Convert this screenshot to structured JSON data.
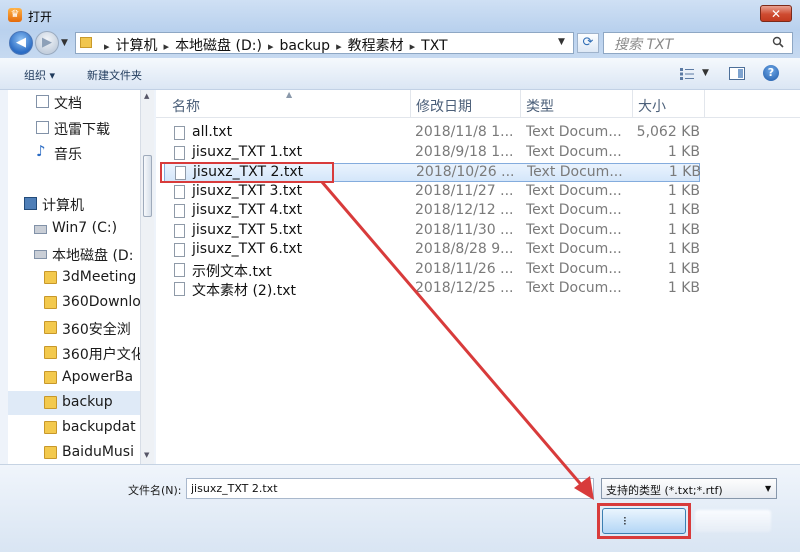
{
  "window": {
    "title": "打开",
    "close_glyph": "✕",
    "app_icon_glyph": "♛"
  },
  "nav": {
    "back_glyph": "◀",
    "forward_glyph": "▶",
    "breadcrumb": [
      "计算机",
      "本地磁盘 (D:)",
      "backup",
      "教程素材",
      "TXT"
    ],
    "breadcrumb_separator": "▸",
    "refresh_glyph": "⟳",
    "search_placeholder": "搜索 TXT"
  },
  "toolbar": {
    "organize_label": "组织 ▾",
    "newfolder_label": "新建文件夹",
    "help_glyph": "?"
  },
  "sidebar": {
    "items": [
      {
        "label": "文档",
        "icon": "doc"
      },
      {
        "label": "迅雷下载",
        "icon": "doc"
      },
      {
        "label": "音乐",
        "icon": "music"
      },
      {
        "label": "计算机",
        "icon": "computer"
      },
      {
        "label": "Win7 (C:)",
        "icon": "drive"
      },
      {
        "label": "本地磁盘 (D:",
        "icon": "drive"
      },
      {
        "label": "3dMeeting",
        "icon": "folder"
      },
      {
        "label": "360Downlo",
        "icon": "folder"
      },
      {
        "label": "360安全浏",
        "icon": "folder"
      },
      {
        "label": "360用户文化",
        "icon": "folder"
      },
      {
        "label": "ApowerBa",
        "icon": "folder"
      },
      {
        "label": "backup",
        "icon": "folder",
        "selected": true
      },
      {
        "label": "backupdat",
        "icon": "folder"
      },
      {
        "label": "BaiduMusi",
        "icon": "folder"
      }
    ]
  },
  "columns": {
    "name": "名称",
    "date": "修改日期",
    "type": "类型",
    "size": "大小"
  },
  "files": [
    {
      "name": "all.txt",
      "date": "2018/11/8 1...",
      "type": "Text Docum...",
      "size": "5,062 KB"
    },
    {
      "name": "jisuxz_TXT 1.txt",
      "date": "2018/9/18 1...",
      "type": "Text Docum...",
      "size": "1 KB"
    },
    {
      "name": "jisuxz_TXT 2.txt",
      "date": "2018/10/26 ...",
      "type": "Text Docum...",
      "size": "1 KB",
      "selected": true
    },
    {
      "name": "jisuxz_TXT 3.txt",
      "date": "2018/11/27 ...",
      "type": "Text Docum...",
      "size": "1 KB"
    },
    {
      "name": "jisuxz_TXT 4.txt",
      "date": "2018/12/12 ...",
      "type": "Text Docum...",
      "size": "1 KB"
    },
    {
      "name": "jisuxz_TXT 5.txt",
      "date": "2018/11/30 ...",
      "type": "Text Docum...",
      "size": "1 KB"
    },
    {
      "name": "jisuxz_TXT 6.txt",
      "date": "2018/8/28 9...",
      "type": "Text Docum...",
      "size": "1 KB"
    },
    {
      "name": "示例文本.txt",
      "date": "2018/11/26 ...",
      "type": "Text Docum...",
      "size": "1 KB"
    },
    {
      "name": "文本素材 (2).txt",
      "date": "2018/12/25 ...",
      "type": "Text Docum...",
      "size": "1 KB"
    }
  ],
  "bottom": {
    "filename_label": "文件名(N):",
    "filename_value": "jisuxz_TXT 2.txt",
    "filetype_value": "支持的类型 (*.txt;*.rtf)",
    "open_label": "⁝"
  },
  "colors": {
    "annotation": "#d83b3b",
    "selection_border": "#84acdd"
  }
}
